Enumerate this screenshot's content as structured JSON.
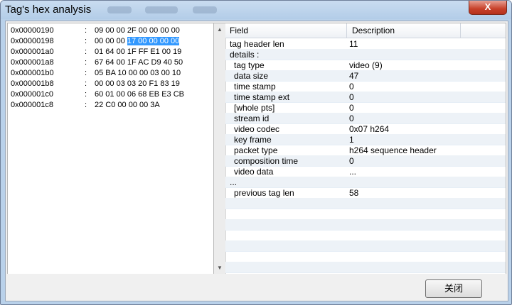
{
  "window": {
    "title": "Tag's hex analysis",
    "close_label": "X"
  },
  "hex_rows": [
    {
      "address": "0x00000190",
      "sep": ":",
      "bytes_before": "09 00 00 2F 00 00 00 00",
      "selected": "",
      "bytes_after": ""
    },
    {
      "address": "0x00000198",
      "sep": ":",
      "bytes_before": "00 00 00 ",
      "selected": "17 00 00 00 00",
      "bytes_after": ""
    },
    {
      "address": "0x000001a0",
      "sep": ":",
      "bytes_before": "01 64 00 1F FF E1 00 19",
      "selected": "",
      "bytes_after": ""
    },
    {
      "address": "0x000001a8",
      "sep": ":",
      "bytes_before": "67 64 00 1F AC D9 40 50",
      "selected": "",
      "bytes_after": ""
    },
    {
      "address": "0x000001b0",
      "sep": ":",
      "bytes_before": "05 BA 10 00 00 03 00 10",
      "selected": "",
      "bytes_after": ""
    },
    {
      "address": "0x000001b8",
      "sep": ":",
      "bytes_before": "00 00 03 03 20 F1 83 19",
      "selected": "",
      "bytes_after": ""
    },
    {
      "address": "0x000001c0",
      "sep": ":",
      "bytes_before": "60 01 00 06 68 EB E3 CB",
      "selected": "",
      "bytes_after": ""
    },
    {
      "address": "0x000001c8",
      "sep": ":",
      "bytes_before": "22 C0 00 00 00 3A",
      "selected": "",
      "bytes_after": ""
    }
  ],
  "table": {
    "columns": [
      "Field",
      "Description"
    ],
    "rows": [
      {
        "field": "tag header len",
        "description": "11",
        "indent": 0
      },
      {
        "field": "details :",
        "description": "",
        "indent": 0
      },
      {
        "field": "tag type",
        "description": "video (9)",
        "indent": 1
      },
      {
        "field": "data size",
        "description": "47",
        "indent": 1
      },
      {
        "field": "time stamp",
        "description": "0",
        "indent": 1
      },
      {
        "field": "time stamp ext",
        "description": "0",
        "indent": 1
      },
      {
        "field": "[whole pts]",
        "description": "0",
        "indent": 1
      },
      {
        "field": "stream id",
        "description": "0",
        "indent": 1
      },
      {
        "field": "video codec",
        "description": "0x07  h264",
        "indent": 1
      },
      {
        "field": "key frame",
        "description": "1",
        "indent": 1
      },
      {
        "field": "packet type",
        "description": "h264 sequence header",
        "indent": 1
      },
      {
        "field": "composition time",
        "description": "0",
        "indent": 1
      },
      {
        "field": "video data",
        "description": "...",
        "indent": 1
      },
      {
        "field": "...",
        "description": "",
        "indent": 0
      },
      {
        "field": "previous tag len",
        "description": "58",
        "indent": 1
      }
    ],
    "total_rows": 22
  },
  "buttons": {
    "close_label": "关闭"
  }
}
